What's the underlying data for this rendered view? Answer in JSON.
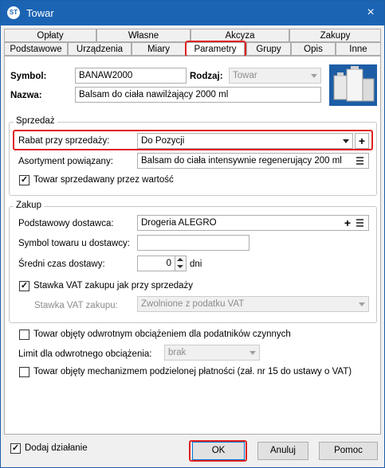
{
  "window": {
    "title": "Towar",
    "app_icon": "app-logo-icon",
    "close": "×"
  },
  "tabs_row1": [
    "Opłaty",
    "Własne",
    "Akcyza",
    "Zakupy"
  ],
  "tabs_row2": [
    "Podstawowe",
    "Urządzenia",
    "Miary",
    "Parametry",
    "Grupy",
    "Opis",
    "Inne"
  ],
  "header": {
    "symbol_label": "Symbol:",
    "symbol_value": "BANAW2000",
    "rodzaj_label": "Rodzaj:",
    "rodzaj_value": "Towar",
    "nazwa_label": "Nazwa:",
    "nazwa_value": "Balsam do ciała nawilżający 2000 ml",
    "product_image": "product-bottles-image"
  },
  "sprzedaz": {
    "title": "Sprzedaż",
    "rabat_label": "Rabat przy sprzedaży:",
    "rabat_value": "Do Pozycji",
    "rabat_add": "+",
    "asortyment_label": "Asortyment powiązany:",
    "asortyment_value": "Balsam do ciała intensywnie regenerujący 200 ml",
    "wartosc_label": "Towar sprzedawany przez wartość",
    "wartosc_checked": "✓"
  },
  "zakup": {
    "title": "Zakup",
    "dostawca_label": "Podstawowy dostawca:",
    "dostawca_value": "Drogeria ALEGRO",
    "dostawca_add": "+",
    "symbol_dost_label": "Symbol towaru u dostawcy:",
    "symbol_dost_value": "",
    "czas_label": "Średni czas dostawy:",
    "czas_value": "0",
    "czas_unit": "dni",
    "vat_same_label": "Stawka VAT zakupu jak przy sprzedaży",
    "vat_same_checked": "✓",
    "vat_label": "Stawka VAT zakupu:",
    "vat_value": "Zwolnione z podatku VAT"
  },
  "other": {
    "odwrotne_label": "Towar objęty odwrotnym obciążeniem dla podatników czynnych",
    "limit_label": "Limit dla odwrotnego obciążenia:",
    "limit_value": "brak",
    "mpp_label": "Towar objęty mechanizmem podzielonej płatności (zał. nr 15 do ustawy o VAT)"
  },
  "footer": {
    "dodaj_label": "Dodaj działanie",
    "dodaj_checked": "✓",
    "ok": "OK",
    "anuluj": "Anuluj",
    "pomoc": "Pomoc"
  },
  "colors": {
    "titlebar": "#1b64b4",
    "highlight": "#e02020"
  }
}
